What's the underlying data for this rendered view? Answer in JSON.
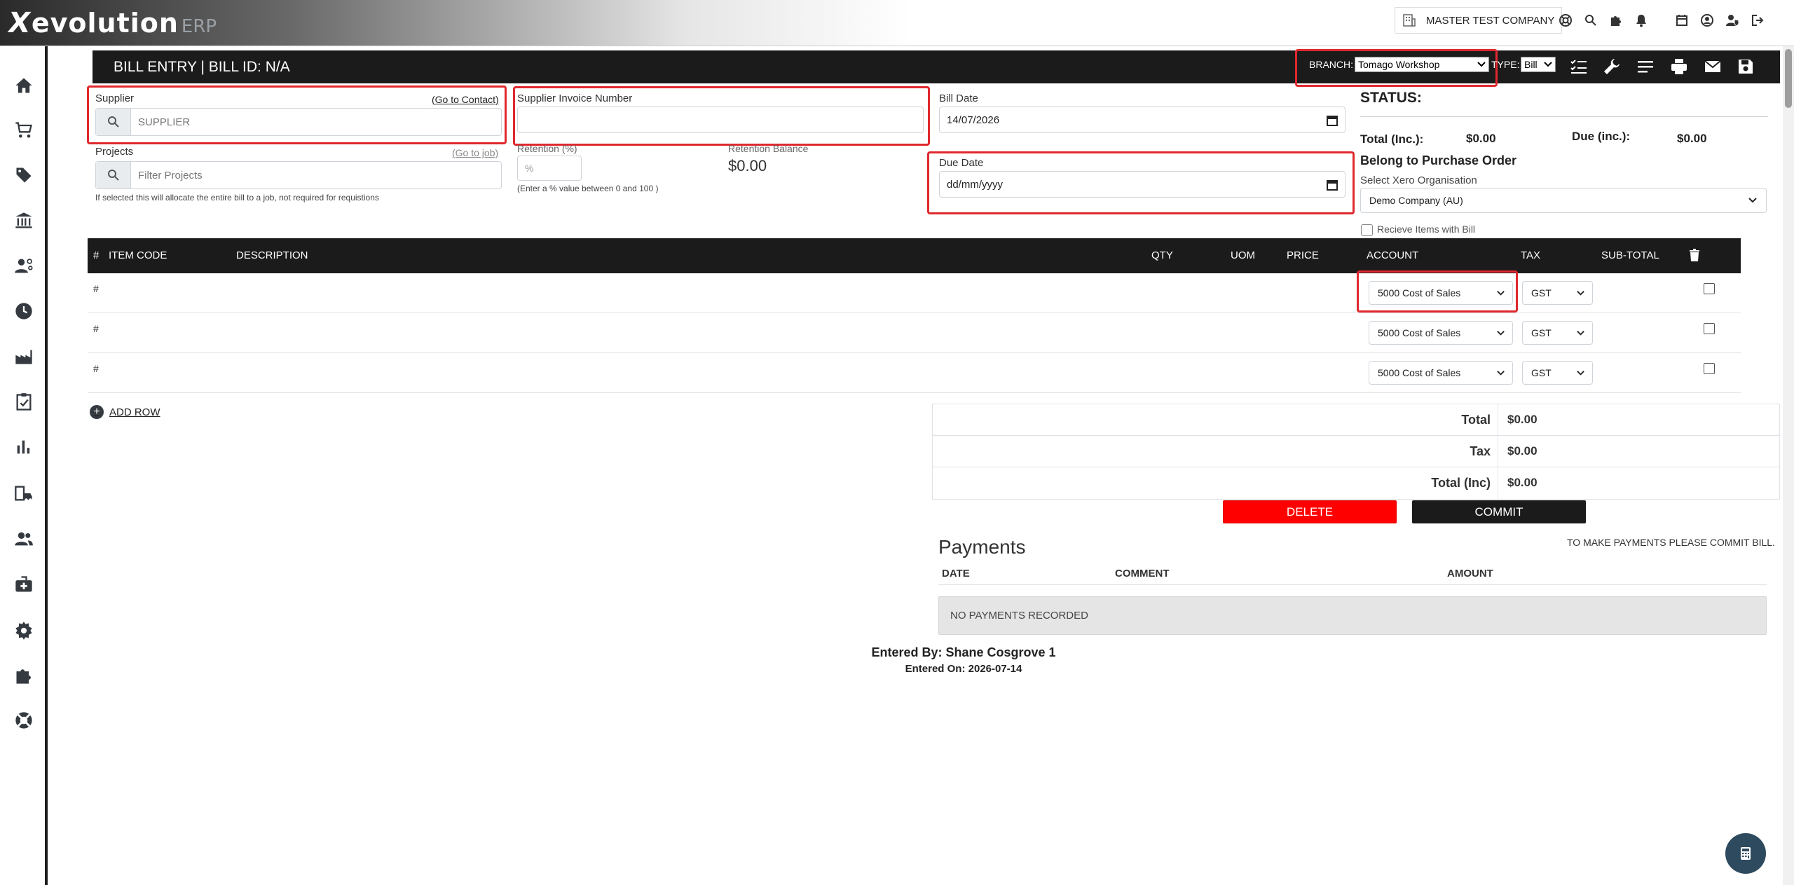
{
  "brand": {
    "name": "evolution",
    "suffix": "ERP"
  },
  "top": {
    "company": "MASTER TEST COMPANY"
  },
  "header": {
    "title": "BILL ENTRY | BILL ID: N/A",
    "branch_label": "BRANCH:",
    "branch_value": "Tomago Workshop",
    "type_label": "TYPE:",
    "type_value": "Bill"
  },
  "form": {
    "supplier_label": "Supplier",
    "goto_contact": "(Go to Contact)",
    "supplier_placeholder": "SUPPLIER",
    "invoice_label": "Supplier Invoice Number",
    "invoice_value": "",
    "bill_date_label": "Bill Date",
    "bill_date_value": "14/07/2026",
    "projects_label": "Projects",
    "goto_job": "(Go to job)",
    "projects_placeholder": "Filter Projects",
    "projects_help": "If selected this will allocate the entire bill to a job, not required for requistions",
    "retention_label": "Retention (%)",
    "retention_placeholder": "%",
    "retention_help": "(Enter a % value between 0 and 100 )",
    "retention_balance_label": "Retention Balance",
    "retention_balance_value": "$0.00",
    "due_date_label": "Due Date",
    "due_date_value": "dd/mm/yyyy"
  },
  "status": {
    "title": "STATUS:",
    "total_inc_label": "Total (Inc.):",
    "total_inc_value": "$0.00",
    "due_inc_label": "Due (inc.):",
    "due_inc_value": "$0.00",
    "belong_po": "Belong to Purchase Order",
    "xero_label": "Select Xero Organisation",
    "xero_value": "Demo Company (AU)",
    "receive_label": "Recieve Items with Bill"
  },
  "table": {
    "headers": {
      "hash": "#",
      "item_code": "ITEM CODE",
      "description": "DESCRIPTION",
      "qty": "QTY",
      "uom": "UOM",
      "price": "PRICE",
      "account": "ACCOUNT",
      "tax": "TAX",
      "subtotal": "SUB-TOTAL"
    },
    "rows": [
      {
        "hash": "#",
        "account": "5000 Cost of Sales",
        "tax": "GST"
      },
      {
        "hash": "#",
        "account": "5000 Cost of Sales",
        "tax": "GST"
      },
      {
        "hash": "#",
        "account": "5000 Cost of Sales",
        "tax": "GST"
      }
    ],
    "add_row": "ADD ROW"
  },
  "totals": {
    "total_label": "Total",
    "total_value": "$0.00",
    "tax_label": "Tax",
    "tax_value": "$0.00",
    "total_inc_label": "Total (Inc)",
    "total_inc_value": "$0.00"
  },
  "actions": {
    "delete": "DELETE",
    "commit": "COMMIT"
  },
  "payments": {
    "title": "Payments",
    "note": "TO MAKE PAYMENTS PLEASE COMMIT BILL.",
    "col_date": "DATE",
    "col_comment": "COMMENT",
    "col_amount": "AMOUNT",
    "empty": "NO PAYMENTS RECORDED"
  },
  "footer": {
    "entered_by": "Entered By: Shane Cosgrove 1",
    "entered_on": "Entered On: 2026-07-14"
  },
  "colors": {
    "highlight": "#e0282e",
    "delete": "#ff0000",
    "dark": "#1b1b1b"
  }
}
